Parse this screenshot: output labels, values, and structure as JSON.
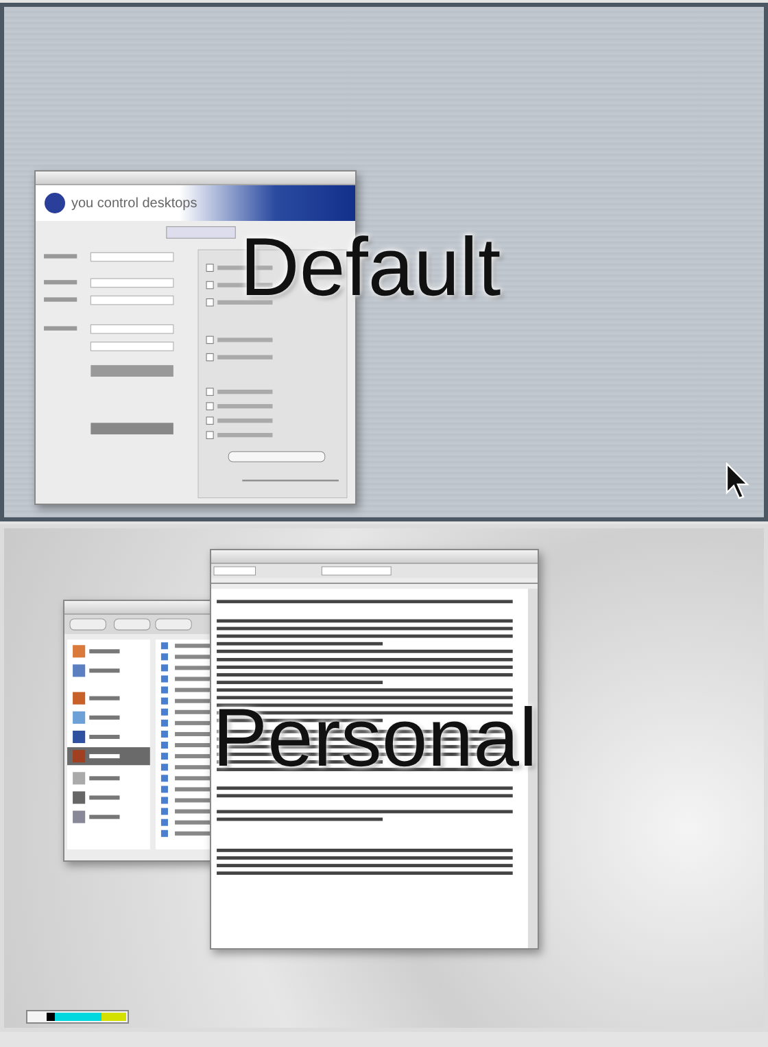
{
  "desktops": [
    {
      "name": "Default",
      "selected": true,
      "kind": "settings",
      "logo_text": "you control desktops"
    },
    {
      "name": "Personal",
      "selected": false,
      "kind": "documents"
    }
  ],
  "color_strip": [
    {
      "color": "#000000"
    },
    {
      "color": "#00d8e0"
    },
    {
      "color": "#d4e000"
    }
  ]
}
